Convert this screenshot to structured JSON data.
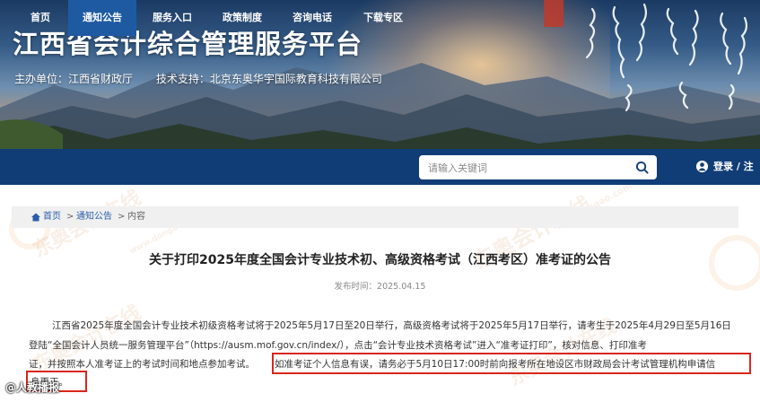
{
  "header": {
    "site_title": "江西省会计综合管理服务平台",
    "organizer": "主办单位：江西省财政厅",
    "tech_support": "技术支持：北京东奥华宇国际教育科技有限公司"
  },
  "nav": {
    "items": [
      {
        "label": "首页"
      },
      {
        "label": "通知公告"
      },
      {
        "label": "服务入口"
      },
      {
        "label": "政策制度"
      },
      {
        "label": "咨询电话"
      },
      {
        "label": "下载专区"
      }
    ],
    "active_index": 1,
    "search_placeholder": "请输入关键词",
    "login_label": "登录 / 注册"
  },
  "breadcrumb": {
    "home": "首页",
    "sep1": ">",
    "section": "通知公告",
    "sep2": ">",
    "current": "内容"
  },
  "article": {
    "title": "关于打印2025年度全国会计专业技术初、高级资格考试（江西考区）准考证的公告",
    "publish_time": "发布时间：2025.04.15",
    "lines": [
      "江西省2025年度全国会计专业技术初级资格考试将于2025年5月17日至20日举行，高级资格考试将于2025年5月17日举行，请考生于2025年4月29日至5月16日",
      "登陆“全国会计人员统一服务管理平台”（https://ausm.mof.gov.cn/index/），点击“会计专业技术资格考试”进入“准考证打印”，核对信息、打印准考",
      "证，并按照本人准考证上的考试时间和地点参加考试。",
      "如准考证个人信息有误，请务必于5月10日17:00时前向报考所在地设区市财政局会计考试管理机构申请信",
      "息更正。"
    ]
  },
  "watermark": {
    "text1": "东奥会计在线",
    "text2": "www.dongao.com"
  },
  "corner_badge": "@人教播报",
  "colors": {
    "nav_bg": "#113d77",
    "nav_active": "#1d5aa2",
    "highlight": "#d9261c"
  }
}
